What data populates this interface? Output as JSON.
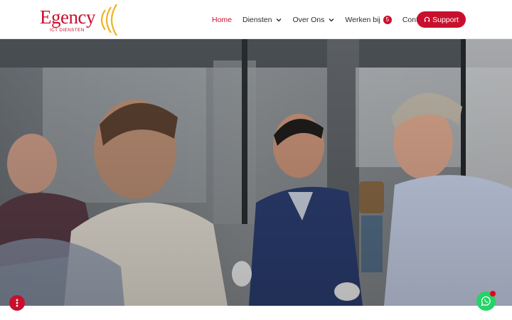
{
  "brand": {
    "name": "Egency",
    "tagline": "ICT DIENSTEN",
    "primary_color": "#c8102e",
    "accent_color": "#f0b323"
  },
  "nav": {
    "items": [
      {
        "label": "Home",
        "active": true,
        "dropdown": false
      },
      {
        "label": "Diensten",
        "active": false,
        "dropdown": true
      },
      {
        "label": "Over Ons",
        "active": false,
        "dropdown": true
      },
      {
        "label": "Werken bij",
        "active": false,
        "dropdown": false,
        "badge": "5"
      },
      {
        "label": "Contact",
        "active": false,
        "dropdown": false
      }
    ],
    "support_label": "Support",
    "support_icon": "headset-icon"
  },
  "hero": {
    "image_alt": "team-photo"
  },
  "floating": {
    "info_icon": "vertical-dots-icon",
    "chat_icon": "whatsapp-icon"
  }
}
